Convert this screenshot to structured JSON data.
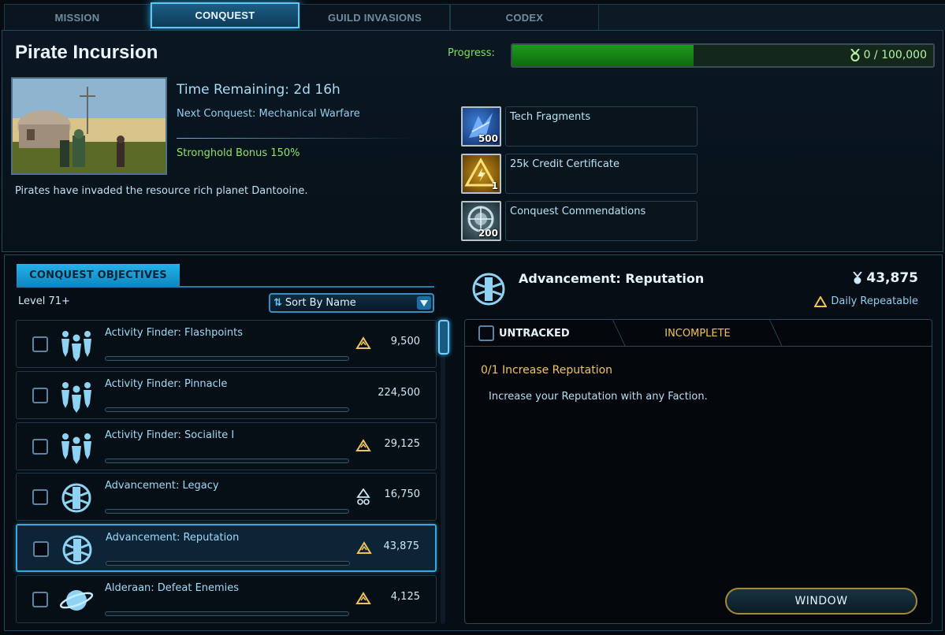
{
  "tabs": [
    {
      "label": "MISSION"
    },
    {
      "label": "CONQUEST"
    },
    {
      "label": "GUILD INVASIONS"
    },
    {
      "label": "CODEX"
    }
  ],
  "conquest": {
    "title": "Pirate Incursion",
    "progress_label": "Progress:",
    "progress_text": "0 / 100,000",
    "progress_fraction": 0.43,
    "time_remaining": "Time Remaining: 2d 16h",
    "next_conquest": "Next Conquest: Mechanical Warfare",
    "stronghold_bonus": "Stronghold Bonus 150%",
    "description": "Pirates have invaded the resource rich planet Dantooine."
  },
  "rewards": [
    {
      "name": "Tech Fragments",
      "count": "500",
      "icon": "tech-fragments-icon"
    },
    {
      "name": "25k Credit Certificate",
      "count": "1",
      "icon": "credit-certificate-icon"
    },
    {
      "name": "Conquest Commendations",
      "count": "200",
      "icon": "conquest-commendations-icon"
    }
  ],
  "objectives": {
    "tab_label": "CONQUEST OBJECTIVES",
    "level": "Level 71+",
    "sort_label": "Sort By Name",
    "rows": [
      {
        "name": "Activity Finder: Flashpoints",
        "value": "9,500",
        "icon": "group-icon",
        "repeat": "daily"
      },
      {
        "name": "Activity Finder: Pinnacle",
        "value": "224,500",
        "icon": "group-icon",
        "repeat": "none"
      },
      {
        "name": "Activity Finder: Socialite I",
        "value": "29,125",
        "icon": "group-icon",
        "repeat": "daily"
      },
      {
        "name": "Advancement: Legacy",
        "value": "16,750",
        "icon": "republic-emblem-icon",
        "repeat": "infinite"
      },
      {
        "name": "Advancement: Reputation",
        "value": "43,875",
        "icon": "republic-emblem-icon",
        "repeat": "daily"
      },
      {
        "name": "Alderaan: Defeat Enemies",
        "value": "4,125",
        "icon": "planet-icon",
        "repeat": "daily"
      }
    ]
  },
  "detail": {
    "title": "Advancement: Reputation",
    "value": "43,875",
    "repeat_label": "Daily Repeatable",
    "untracked_label": "UNTRACKED",
    "incomplete_label": "INCOMPLETE",
    "task": "0/1 Increase Reputation",
    "task_description": "Increase your Reputation with any Faction.",
    "window_button": "WINDOW"
  },
  "colors": {
    "accent": "#3ea7d8",
    "progress_green": "#1c9a1a",
    "gold": "#f0c35a"
  }
}
